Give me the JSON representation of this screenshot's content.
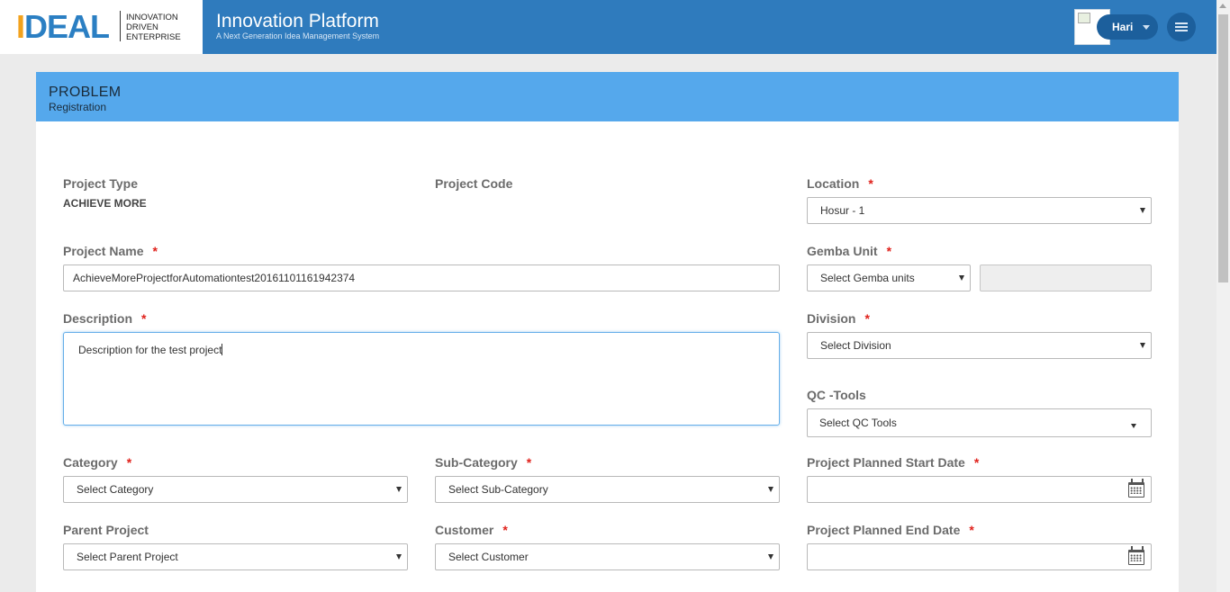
{
  "header": {
    "logo_text_prefix": "I",
    "logo_text_main": "DEAL",
    "logo_tagline": [
      "INNOVATION",
      "DRIVEN",
      "ENTERPRISE"
    ],
    "title": "Innovation Platform",
    "subtitle": "A Next Generation Idea Management System",
    "user_name": "Hari"
  },
  "panel": {
    "title": "PROBLEM",
    "subtitle": "Registration"
  },
  "form": {
    "project_type": {
      "label": "Project Type",
      "value": "ACHIEVE MORE"
    },
    "project_code": {
      "label": "Project Code"
    },
    "location": {
      "label": "Location",
      "required": "*",
      "value": "Hosur - 1"
    },
    "project_name": {
      "label": "Project Name",
      "required": "*",
      "value": "AchieveMoreProjectforAutomationtest20161101161942374"
    },
    "gemba_unit": {
      "label": "Gemba Unit",
      "required": "*",
      "value": "Select Gemba units",
      "extra_value": ""
    },
    "description": {
      "label": "Description",
      "required": "*",
      "value": "Description for the test project"
    },
    "division": {
      "label": "Division",
      "required": "*",
      "value": "Select Division"
    },
    "qc_tools": {
      "label": "QC -Tools",
      "value": "Select QC Tools"
    },
    "category": {
      "label": "Category",
      "required": "*",
      "value": "Select Category"
    },
    "sub_category": {
      "label": "Sub-Category",
      "required": "*",
      "value": "Select Sub-Category"
    },
    "planned_start": {
      "label": "Project Planned Start Date",
      "required": "*",
      "value": ""
    },
    "parent_project": {
      "label": "Parent Project",
      "value": "Select Parent Project"
    },
    "customer": {
      "label": "Customer",
      "required": "*",
      "value": "Select Customer"
    },
    "planned_end": {
      "label": "Project Planned End Date",
      "required": "*",
      "value": ""
    }
  },
  "colors": {
    "header_bg": "#2f7bbd",
    "panel_head_bg": "#55a8ec",
    "required": "#e0211b",
    "logo_blue": "#2b7fc3",
    "logo_orange": "#f2a21d"
  },
  "icons": [
    "menu-icon",
    "calendar-icon",
    "chevron-down-icon",
    "broken-image-icon"
  ]
}
